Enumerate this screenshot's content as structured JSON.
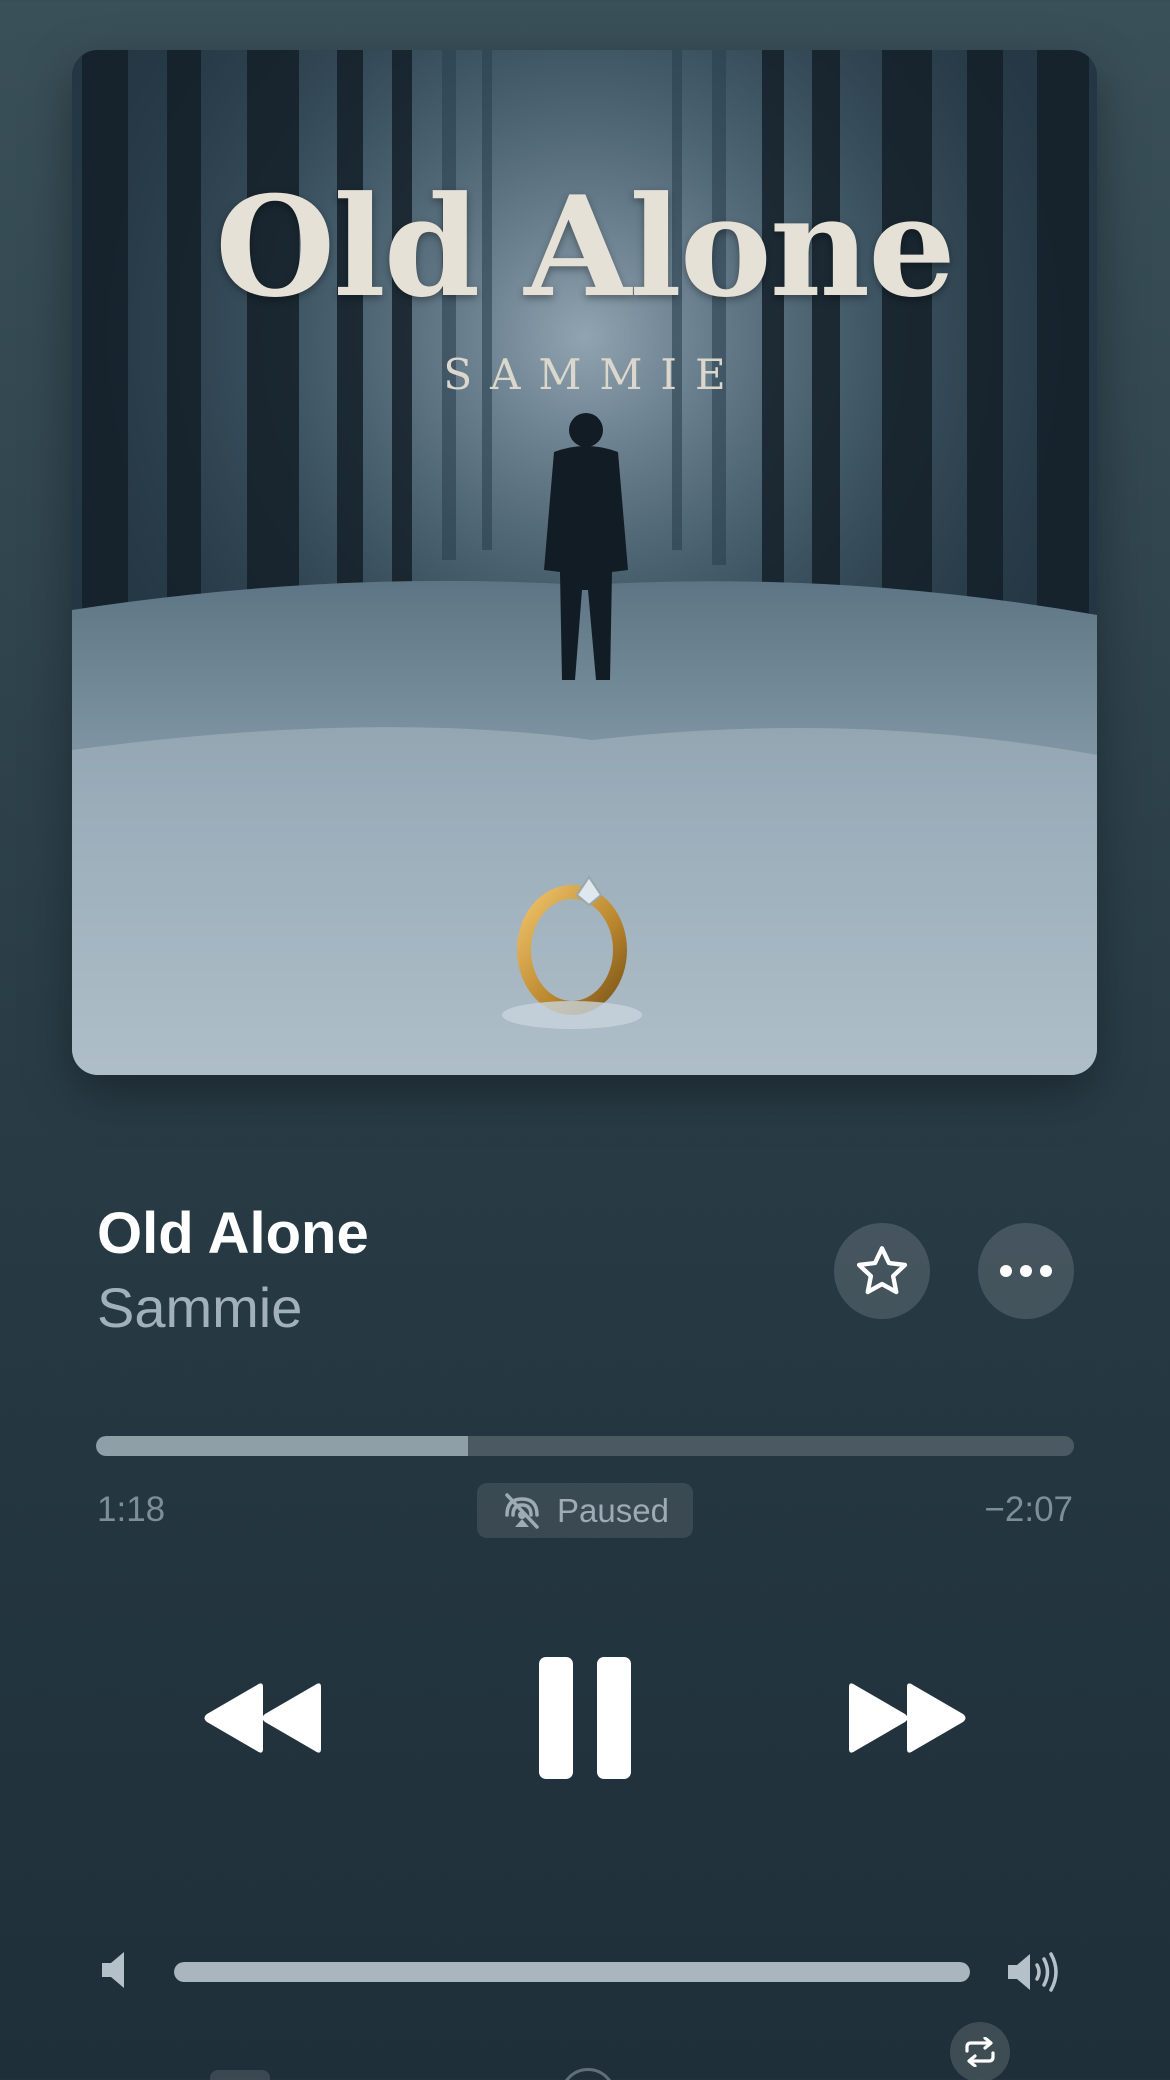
{
  "artwork": {
    "title_text": "Old Alone",
    "artist_text": "SAMMIE"
  },
  "track": {
    "title": "Old Alone",
    "artist": "Sammie"
  },
  "actions": {
    "favorite_icon": "star-icon",
    "more_icon": "ellipsis-icon"
  },
  "playback": {
    "elapsed": "1:18",
    "remaining": "−2:07",
    "progress_fraction": 0.38,
    "status_label": "Paused",
    "status_icon": "airplay-off-icon"
  },
  "controls": {
    "rewind_icon": "rewind-icon",
    "pause_icon": "pause-icon",
    "forward_icon": "fast-forward-icon",
    "repeat_icon": "repeat-icon"
  },
  "volume": {
    "level_fraction": 1.0,
    "low_icon": "speaker-low-icon",
    "high_icon": "speaker-high-icon"
  },
  "colors": {
    "background_top": "#3a5058",
    "background_bottom": "#1f2f39",
    "progress_fill": "#8f9fa8",
    "secondary_text": "#a2b0b9"
  }
}
